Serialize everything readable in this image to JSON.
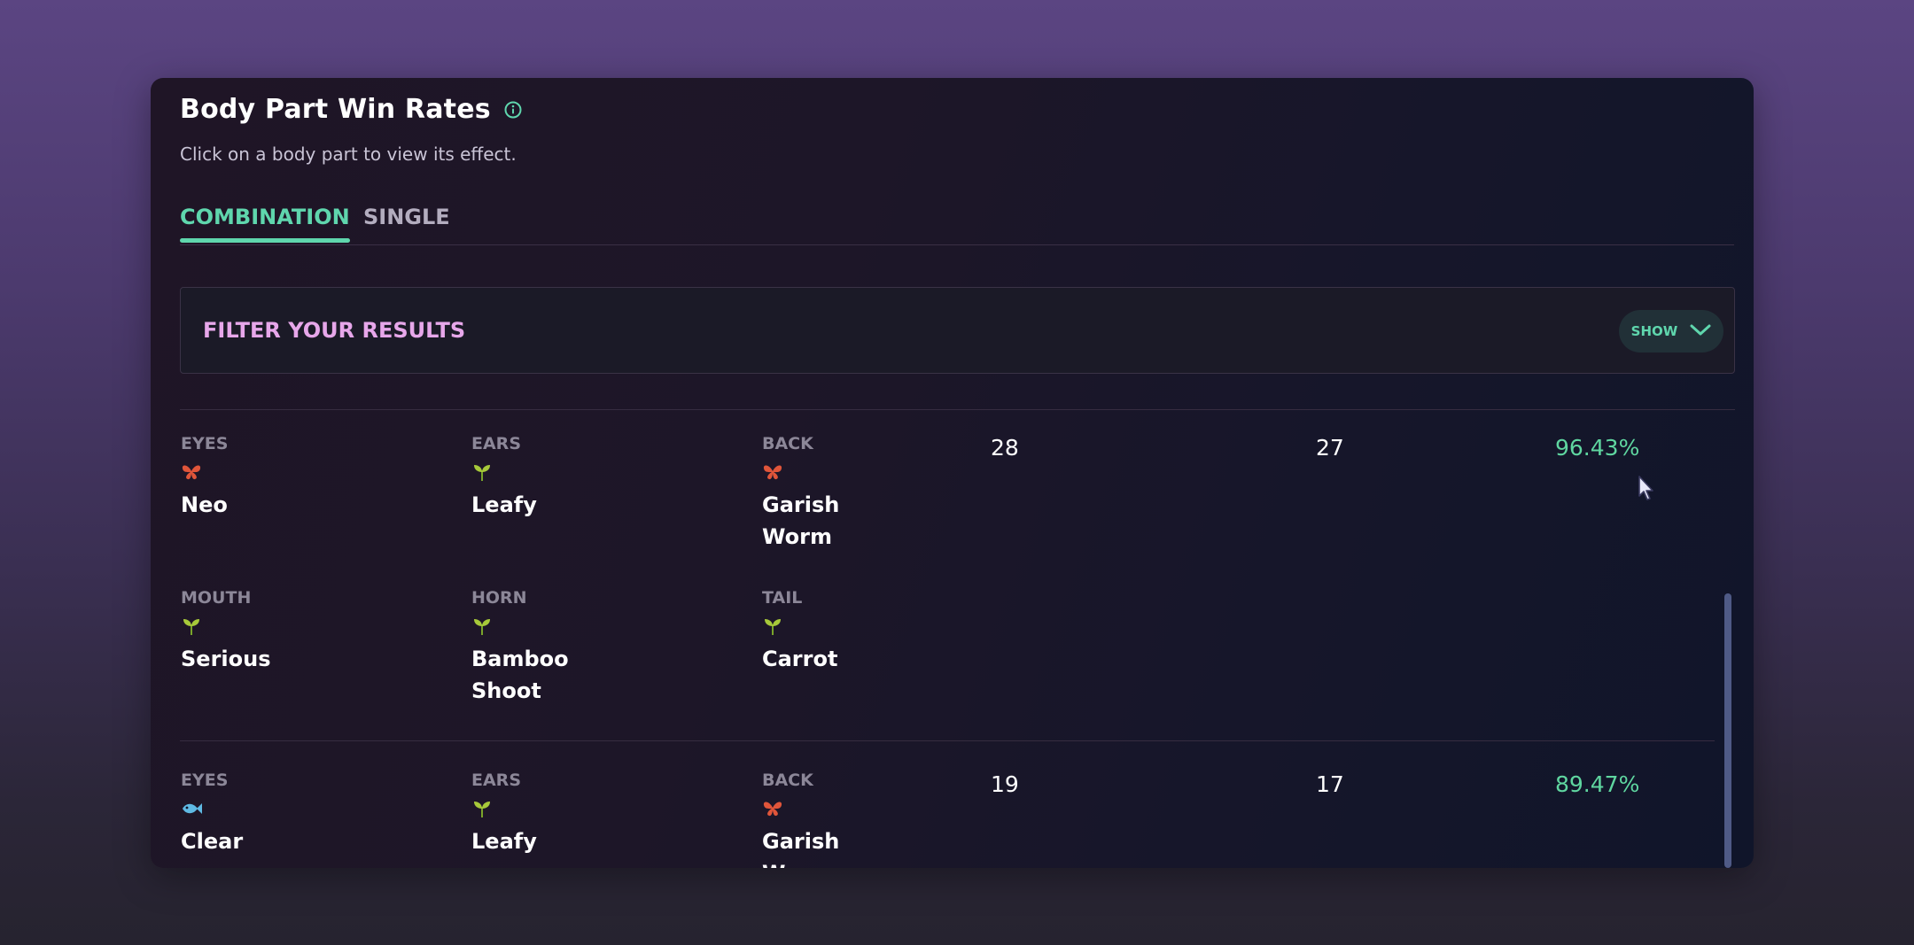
{
  "card": {
    "title": "Body Part Win Rates",
    "subtitle": "Click on a body part to view its effect."
  },
  "tabs": [
    {
      "label": "COMBINATION",
      "active": true
    },
    {
      "label": "SINGLE",
      "active": false
    }
  ],
  "filter": {
    "title": "FILTER YOUR RESULTS",
    "toggle_label": "SHOW"
  },
  "icons": {
    "info": "info-icon",
    "chevron": "chevron-down-icon",
    "bug": "butterfly-icon",
    "plant": "sprout-icon",
    "aquatic": "fish-icon"
  },
  "colors": {
    "accent": "#5fd6ad",
    "filter_title": "#e7a7ea",
    "bug": "#e0553a",
    "plant": "#a7c93a",
    "aquatic": "#5fb9e3",
    "percent": "#5fd6a0"
  },
  "rows": [
    {
      "parts": [
        {
          "label": "EYES",
          "class": "bug",
          "name": "Neo"
        },
        {
          "label": "EARS",
          "class": "plant",
          "name": "Leafy"
        },
        {
          "label": "BACK",
          "class": "bug",
          "name": "Garish Worm"
        },
        {
          "label": "MOUTH",
          "class": "plant",
          "name": "Serious"
        },
        {
          "label": "HORN",
          "class": "plant",
          "name": "Bamboo Shoot"
        },
        {
          "label": "TAIL",
          "class": "plant",
          "name": "Carrot"
        }
      ],
      "total": "28",
      "wins": "27",
      "win_rate": "96.43%"
    },
    {
      "parts": [
        {
          "label": "EYES",
          "class": "aquatic",
          "name": "Clear"
        },
        {
          "label": "EARS",
          "class": "plant",
          "name": "Leafy"
        },
        {
          "label": "BACK",
          "class": "bug",
          "name": "Garish Worm"
        }
      ],
      "total": "19",
      "wins": "17",
      "win_rate": "89.47%"
    }
  ]
}
